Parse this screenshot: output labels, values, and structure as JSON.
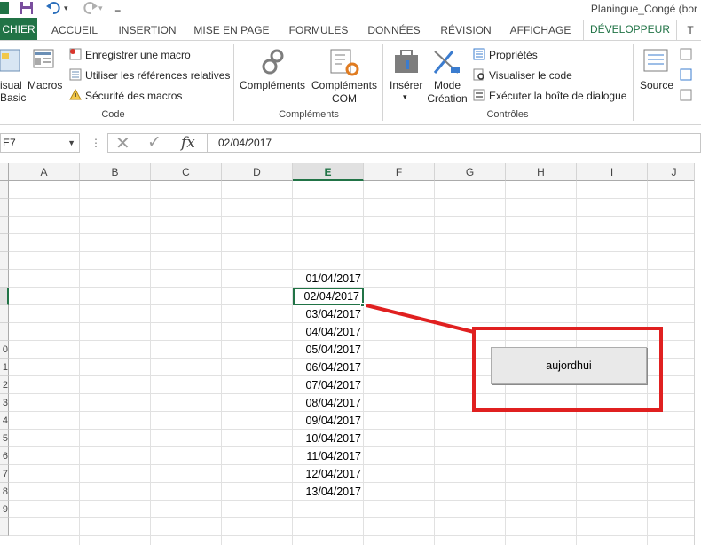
{
  "window": {
    "title": "Planingue_Congé (bor"
  },
  "quick_access": {
    "save_icon": "save-icon",
    "undo_icon": "undo-icon",
    "redo_icon": "redo-icon",
    "customize_icon": "customize-icon"
  },
  "tabs": [
    {
      "label": "CHIER"
    },
    {
      "label": "ACCUEIL"
    },
    {
      "label": "INSERTION"
    },
    {
      "label": "MISE EN PAGE"
    },
    {
      "label": "FORMULES"
    },
    {
      "label": "DONNÉES"
    },
    {
      "label": "RÉVISION"
    },
    {
      "label": "AFFICHAGE"
    },
    {
      "label": "DÉVELOPPEUR"
    },
    {
      "label": "T"
    }
  ],
  "ribbon": {
    "code": {
      "visual_basic": [
        "isual",
        "Basic"
      ],
      "macros": "Macros",
      "record_macro": "Enregistrer une macro",
      "relative_refs": "Utiliser les références relatives",
      "macro_security": "Sécurité des macros",
      "group_label": "Code"
    },
    "addins": {
      "addins": "Compléments",
      "com_addins": [
        "Compléments",
        "COM"
      ],
      "group_label": "Compléments"
    },
    "controls": {
      "insert": "Insérer",
      "design_mode": [
        "Mode",
        "Création"
      ],
      "properties": "Propriétés",
      "view_code": "Visualiser le code",
      "run_dialog": "Exécuter la boîte de dialogue",
      "group_label": "Contrôles"
    },
    "xml": {
      "source": "Source"
    }
  },
  "formula_bar": {
    "name_box": "E7",
    "fx": "fx",
    "value": "02/04/2017"
  },
  "columns": [
    "A",
    "B",
    "C",
    "D",
    "E",
    "F",
    "G",
    "H",
    "I",
    "J"
  ],
  "rows": [
    "",
    "",
    "",
    "",
    "",
    "",
    "",
    "",
    "",
    "0",
    "1",
    "2",
    "3",
    "4",
    "5",
    "6",
    "7",
    "8",
    "9",
    ""
  ],
  "cells": [
    {
      "row": 5,
      "value": "01/04/2017"
    },
    {
      "row": 6,
      "value": "02/04/2017"
    },
    {
      "row": 7,
      "value": "03/04/2017"
    },
    {
      "row": 8,
      "value": "04/04/2017"
    },
    {
      "row": 9,
      "value": "05/04/2017"
    },
    {
      "row": 10,
      "value": "06/04/2017"
    },
    {
      "row": 11,
      "value": "07/04/2017"
    },
    {
      "row": 12,
      "value": "08/04/2017"
    },
    {
      "row": 13,
      "value": "09/04/2017"
    },
    {
      "row": 14,
      "value": "10/04/2017"
    },
    {
      "row": 15,
      "value": "11/04/2017"
    },
    {
      "row": 16,
      "value": "12/04/2017"
    },
    {
      "row": 17,
      "value": "13/04/2017"
    }
  ],
  "button": {
    "label": "aujordhui"
  },
  "colors": {
    "accent": "#217346",
    "annotation": "#e02020"
  }
}
